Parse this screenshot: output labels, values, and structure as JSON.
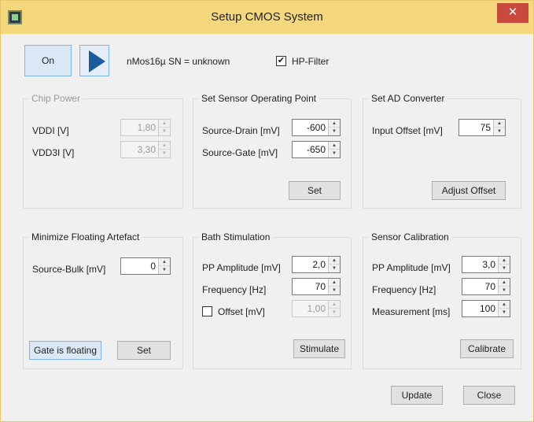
{
  "window": {
    "title": "Setup CMOS System",
    "close_glyph": "✕"
  },
  "top": {
    "on_label": "On",
    "device_info": "nMos16µ  SN = unknown",
    "hp_filter_label": "HP-Filter",
    "hp_filter_checked": true
  },
  "chip_power": {
    "title": "Chip Power",
    "vddi_label": "VDDI [V]",
    "vddi_value": "1,80",
    "vdd3i_label": "VDD3I [V]",
    "vdd3i_value": "3,30"
  },
  "sensor_op": {
    "title": "Set Sensor Operating Point",
    "source_drain_label": "Source-Drain [mV]",
    "source_drain_value": "-600",
    "source_gate_label": "Source-Gate [mV]",
    "source_gate_value": "-650",
    "set_label": "Set"
  },
  "ad_converter": {
    "title": "Set AD Converter",
    "input_offset_label": "Input Offset [mV]",
    "input_offset_value": "75",
    "adjust_label": "Adjust Offset"
  },
  "floating": {
    "title": "Minimize Floating Artefact",
    "source_bulk_label": "Source-Bulk [mV]",
    "source_bulk_value": "0",
    "gate_floating_label": "Gate is floating",
    "set_label": "Set"
  },
  "bath": {
    "title": "Bath Stimulation",
    "pp_amp_label": "PP Amplitude [mV]",
    "pp_amp_value": "2,0",
    "freq_label": "Frequency [Hz]",
    "freq_value": "70",
    "offset_label": "Offset [mV]",
    "offset_checked": false,
    "offset_value": "1,00",
    "stimulate_label": "Stimulate"
  },
  "calibration": {
    "title": "Sensor Calibration",
    "pp_amp_label": "PP Amplitude [mV]",
    "pp_amp_value": "3,0",
    "freq_label": "Frequency [Hz]",
    "freq_value": "70",
    "meas_label": "Measurement [ms]",
    "meas_value": "100",
    "calibrate_label": "Calibrate"
  },
  "footer": {
    "update_label": "Update",
    "close_label": "Close"
  }
}
